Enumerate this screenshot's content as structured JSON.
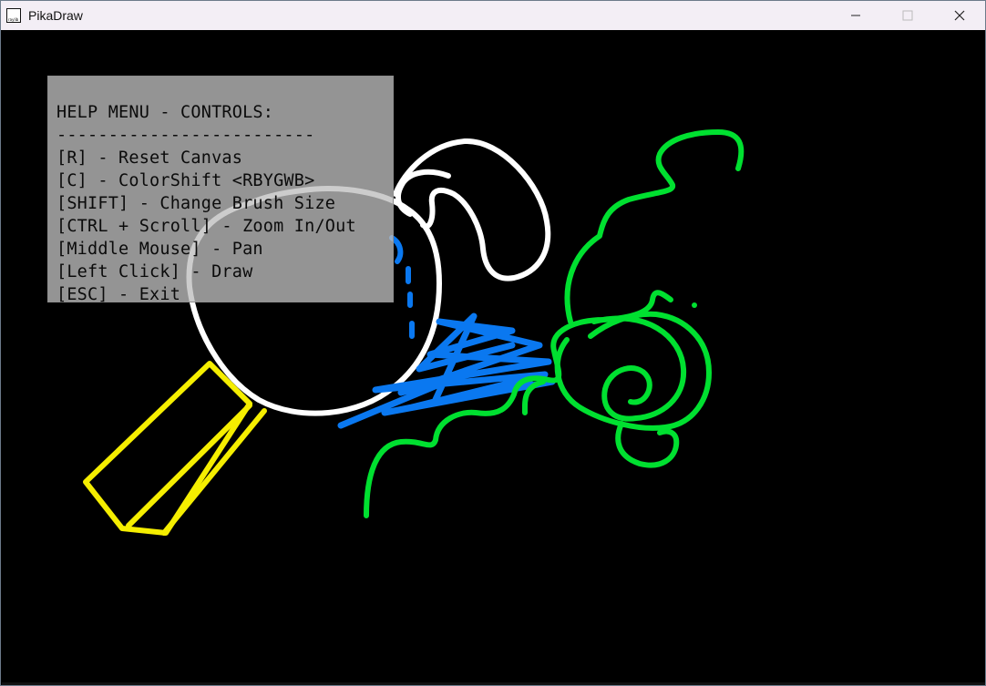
{
  "window": {
    "title": "PikaDraw",
    "icon": "raylib-icon",
    "icon_text": "raylib"
  },
  "controls": {
    "minimize": "minimize-icon",
    "maximize": "maximize-icon",
    "close": "close-icon"
  },
  "help": {
    "lines": [
      "HELP MENU - CONTROLS:",
      "-------------------------",
      "[R] - Reset Canvas",
      "[C] - ColorShift <RBYGWB>",
      "[SHIFT] - Change Brush Size",
      "[CTRL + Scroll] - Zoom In/Out",
      "[Middle Mouse] - Pan",
      "[Left Click] - Draw",
      "[ESC] - Exit"
    ]
  },
  "colors": {
    "canvas": "#000000",
    "white_stroke": "#ffffff",
    "yellow_stroke": "#f5ee00",
    "green_stroke": "#00e030",
    "blue_stroke": "#0a78f0"
  }
}
